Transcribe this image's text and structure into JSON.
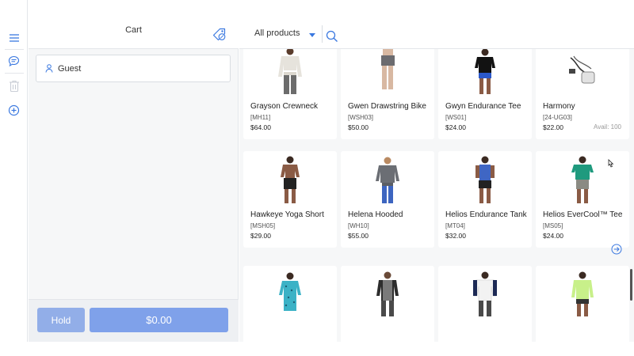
{
  "sidebar": {
    "icons": [
      "menu-icon",
      "comment-icon",
      "trash-icon",
      "add-circle-icon"
    ]
  },
  "cart": {
    "title": "Cart",
    "customer_label": "Guest",
    "hold_label": "Hold",
    "total_label": "$0.00"
  },
  "products": {
    "filter_label": "All products",
    "items": [
      {
        "name": "Grayson Crewneck",
        "sku": "[MH11]",
        "price": "$64.00",
        "avail": ""
      },
      {
        "name": "Gwen Drawstring Bike",
        "sku": "[WSH03]",
        "price": "$50.00",
        "avail": ""
      },
      {
        "name": "Gwyn Endurance Tee",
        "sku": "[WS01]",
        "price": "$24.00",
        "avail": ""
      },
      {
        "name": "Harmony",
        "sku": "[24-UG03]",
        "price": "$22.00",
        "avail": "Avail: 100"
      },
      {
        "name": "Hawkeye Yoga Short",
        "sku": "[MSH05]",
        "price": "$29.00",
        "avail": ""
      },
      {
        "name": "Helena Hooded",
        "sku": "[WH10]",
        "price": "$55.00",
        "avail": ""
      },
      {
        "name": "Helios Endurance Tank",
        "sku": "[MT04]",
        "price": "$32.00",
        "avail": ""
      },
      {
        "name": "Helios EverCool™ Tee",
        "sku": "[MS05]",
        "price": "$24.00",
        "avail": ""
      },
      {
        "name": "",
        "sku": "",
        "price": "",
        "avail": ""
      },
      {
        "name": "",
        "sku": "",
        "price": "",
        "avail": ""
      },
      {
        "name": "",
        "sku": "",
        "price": "",
        "avail": ""
      },
      {
        "name": "",
        "sku": "",
        "price": "",
        "avail": ""
      }
    ]
  },
  "colors": {
    "accent": "#3a78e0",
    "hold_button": "#92aee8",
    "pay_button": "#7fa1ea"
  }
}
